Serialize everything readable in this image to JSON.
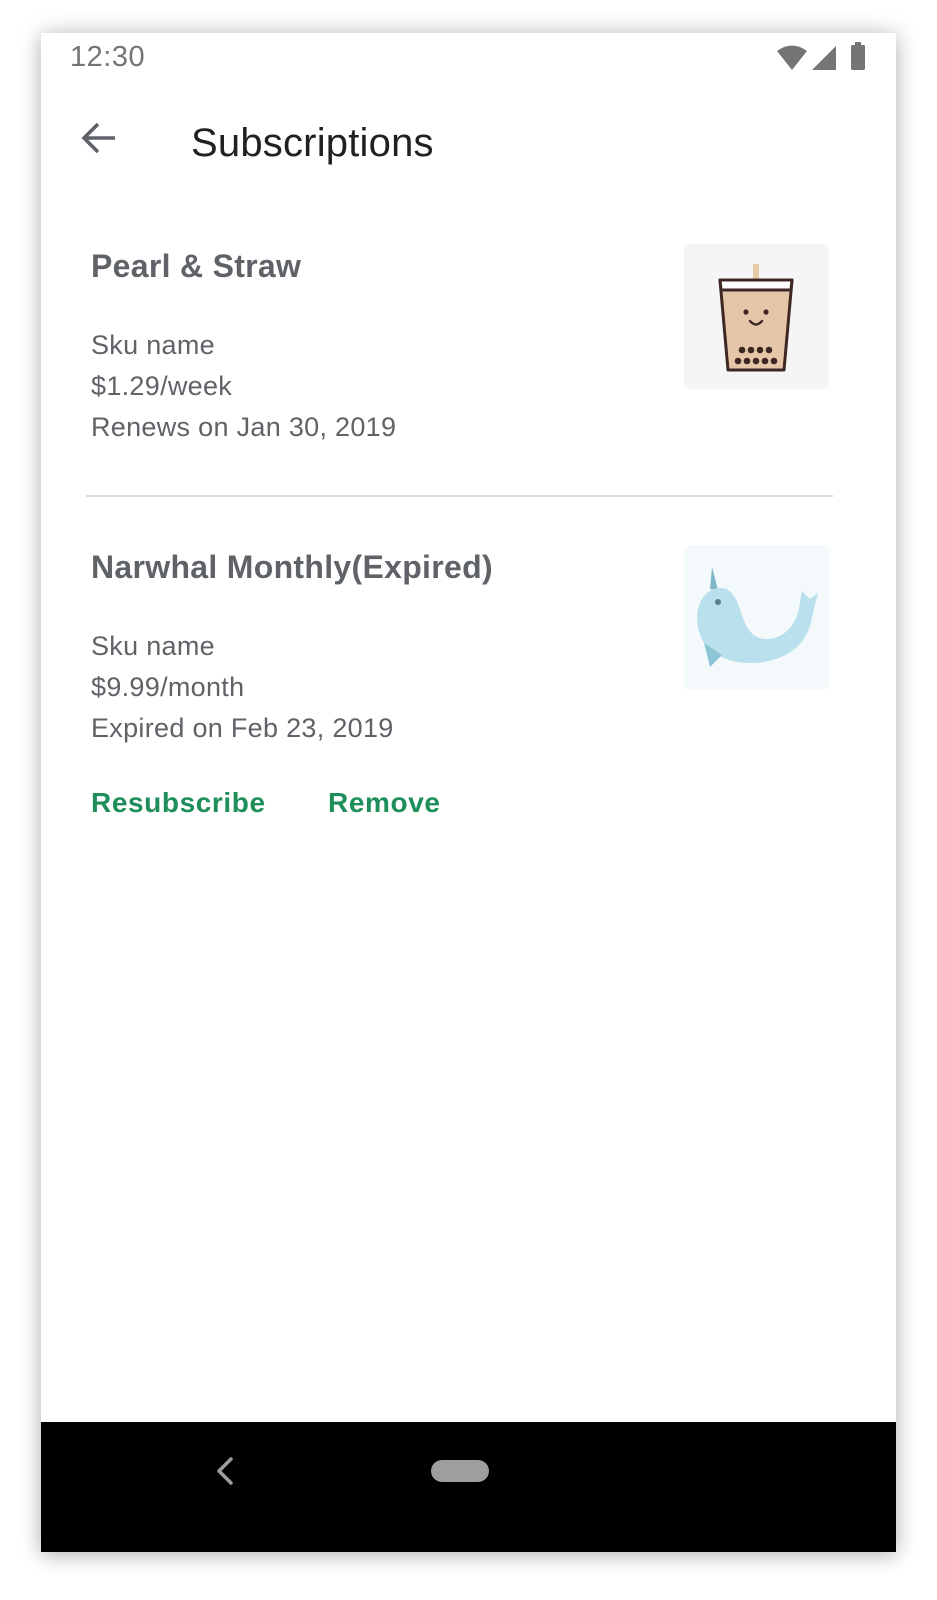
{
  "status_bar": {
    "time": "12:30",
    "icons": [
      "wifi-icon",
      "cell-signal-icon",
      "battery-icon"
    ]
  },
  "app_bar": {
    "title": "Subscriptions",
    "back_icon": "back-arrow-icon"
  },
  "subscriptions": [
    {
      "title": "Pearl & Straw",
      "sku": "Sku name",
      "price": "$1.29/week",
      "status": "Renews on Jan 30, 2019",
      "image": "bubble-tea-icon"
    },
    {
      "title": "Narwhal Monthly(Expired)",
      "sku": "Sku name",
      "price": "$9.99/month",
      "status": "Expired on Feb 23, 2019",
      "image": "narwhal-icon",
      "actions": {
        "resubscribe": "Resubscribe",
        "remove": "Remove"
      }
    }
  ],
  "colors": {
    "accent": "#1e8e5a",
    "title_text": "#202124",
    "secondary_text": "#5f6368",
    "divider": "#dadce0",
    "nav_bar": "#000000"
  },
  "nav_bar": {
    "back_icon": "nav-back-icon",
    "home_icon": "nav-home-pill"
  }
}
